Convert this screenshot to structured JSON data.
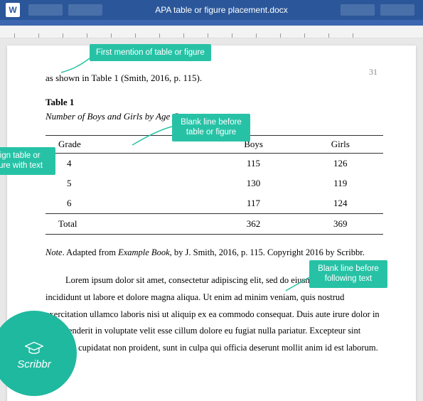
{
  "titlebar": {
    "filename": "APA table or figure placement.docx"
  },
  "page": {
    "number": "31"
  },
  "body": {
    "first_line": "as shown in Table 1 (Smith, 2016, p. 115)."
  },
  "table_meta": {
    "label": "Table 1",
    "title": "Number of Boys and Girls by Age Group"
  },
  "chart_data": {
    "type": "table",
    "columns": [
      "Grade",
      "Boys",
      "Girls"
    ],
    "rows": [
      {
        "Grade": "4",
        "Boys": 115,
        "Girls": 126
      },
      {
        "Grade": "5",
        "Boys": 130,
        "Girls": 119
      },
      {
        "Grade": "6",
        "Boys": 117,
        "Girls": 124
      }
    ],
    "total": {
      "label": "Total",
      "Boys": 362,
      "Girls": 369
    }
  },
  "note": {
    "label": "Note",
    "text_before": ". Adapted from ",
    "source": "Example Book",
    "text_after": ", by J. Smith, 2016, p. 115. Copyright 2016 by Scribbr."
  },
  "paragraph": "Lorem ipsum dolor sit amet, consectetur adipiscing elit, sed do eiusmod tempor incididunt ut labore et dolore magna aliqua. Ut enim ad minim veniam, quis nostrud exercitation ullamco laboris nisi ut aliquip ex ea commodo consequat. Duis aute irure dolor in reprehenderit in voluptate velit esse cillum dolore eu fugiat nulla pariatur. Excepteur sint occaecat cupidatat non proident, sunt in culpa qui officia deserunt mollit anim id est laborum.",
  "callouts": {
    "first_mention": "First mention of table or figure",
    "align": "Align table or figure with text",
    "blank_before": "Blank line before table or figure",
    "blank_after": "Blank line before following text"
  },
  "brand": {
    "name": "Scribbr"
  },
  "colors": {
    "accent": "#27c2a6",
    "word_blue": "#2b579a"
  }
}
